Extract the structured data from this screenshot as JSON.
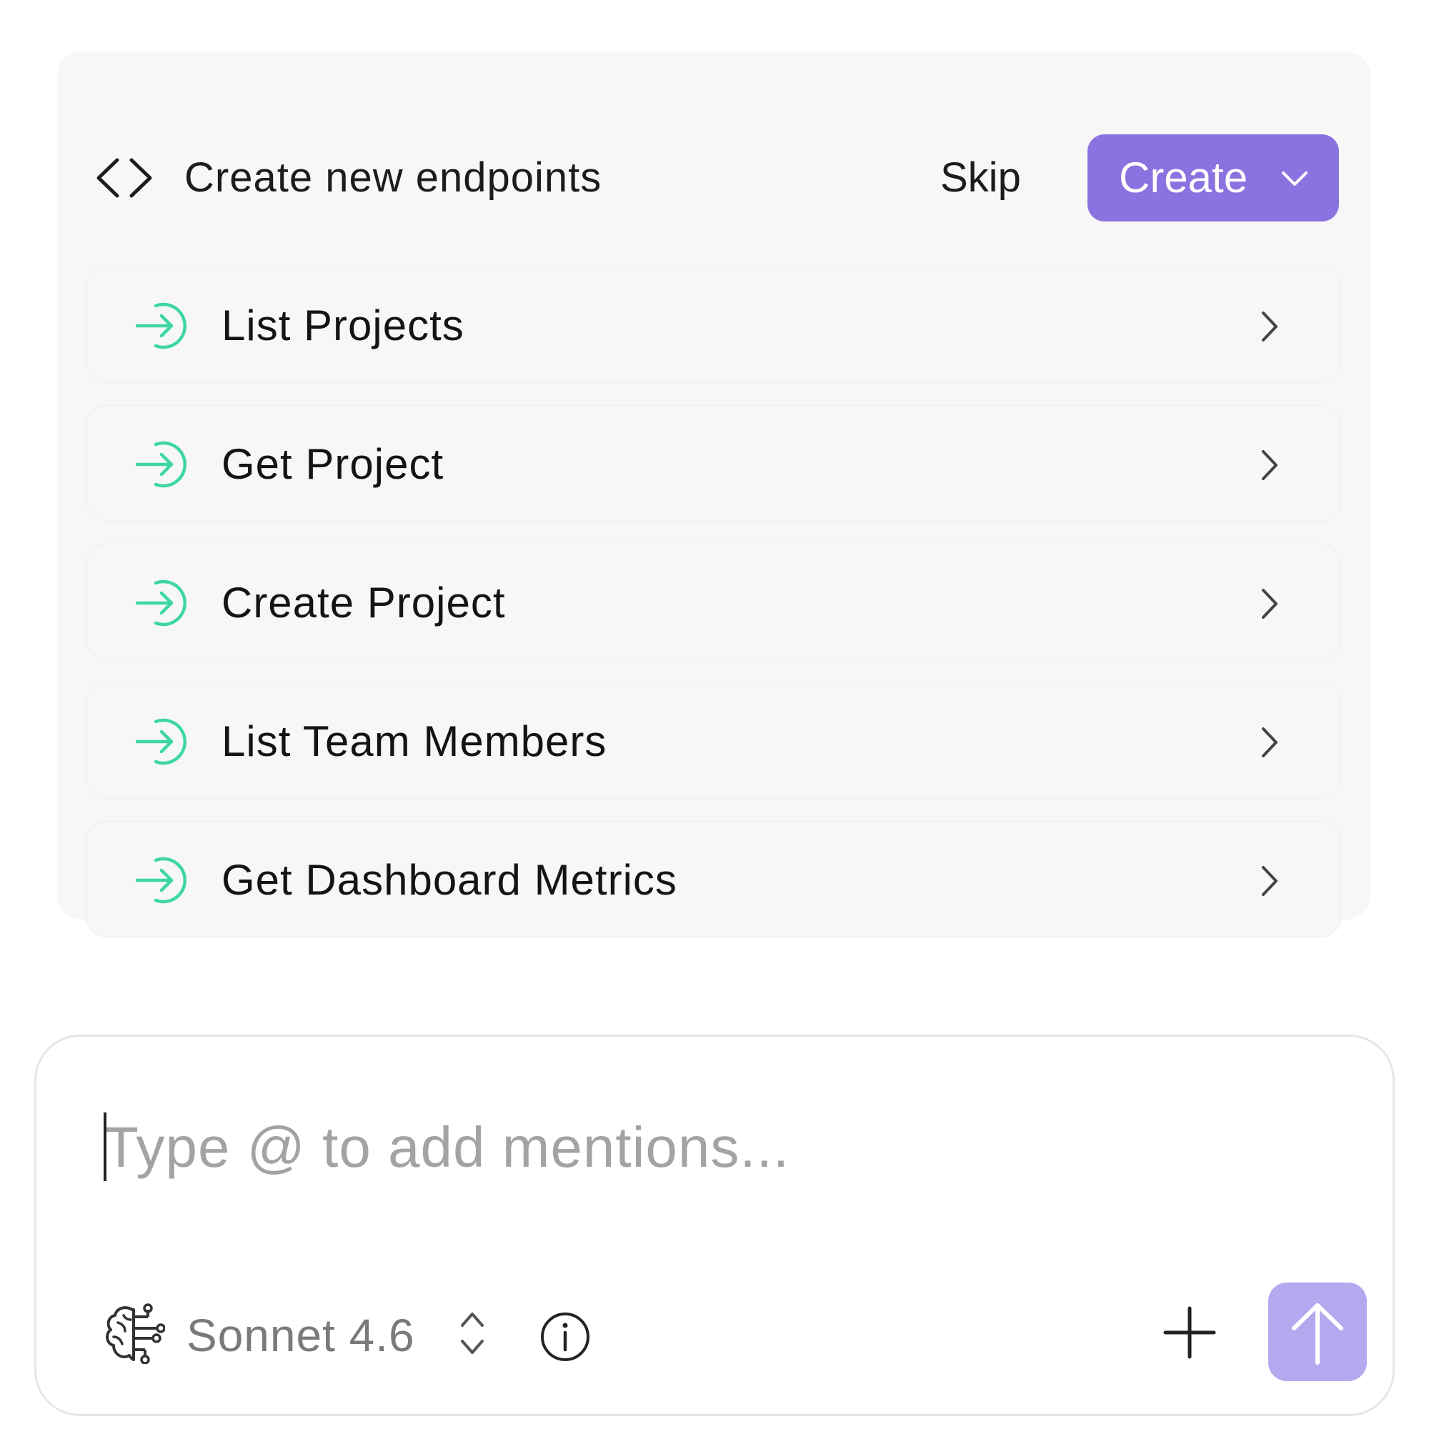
{
  "card": {
    "title": "Create new endpoints",
    "skip_label": "Skip",
    "create_label": "Create",
    "items": [
      {
        "label": "List Projects"
      },
      {
        "label": "Get Project"
      },
      {
        "label": "Create Project"
      },
      {
        "label": "List Team Members"
      },
      {
        "label": "Get Dashboard Metrics"
      }
    ]
  },
  "composer": {
    "placeholder": "Type @ to add mentions...",
    "value": "",
    "model_label": "Sonnet 4.6"
  },
  "icons": {
    "header": "code-brackets-icon",
    "item": "arrow-into-circle-icon",
    "item_chevron": "chevron-right-icon",
    "create_chevron": "chevron-down-icon",
    "model": "brain-circuit-icon",
    "model_switch": "chevron-up-down-icon",
    "info": "info-icon",
    "add": "plus-icon",
    "send": "arrow-up-icon"
  },
  "colors": {
    "accent": "#8a72e0",
    "send_disabled": "#b6a8ee",
    "item_icon": "#3ed6a6",
    "panel_bg": "#f7f7f7",
    "placeholder": "#a3a3a3"
  }
}
